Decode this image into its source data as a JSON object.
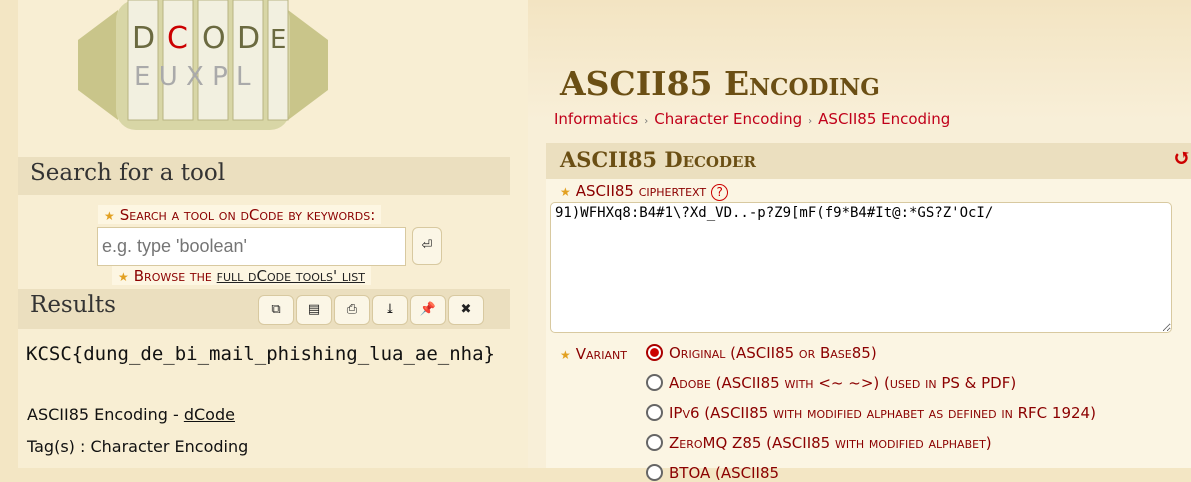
{
  "logo": {
    "text": "dCODE"
  },
  "search": {
    "heading": "Search for a tool",
    "label": "Search a tool on dCode by keywords:",
    "placeholder": "e.g. type 'boolean'",
    "go_icon": "⏎",
    "browse_prefix": "Browse the ",
    "browse_link": "full dCode tools' list"
  },
  "results": {
    "heading": "Results",
    "output": "KCSC{dung_de_bi_mail_phishing_lua_ae_nha}",
    "source_prefix": "ASCII85 Encoding - ",
    "source_link": "dCode",
    "tags": "Tag(s) : Character Encoding",
    "toolbar": [
      {
        "icon": "copy-icon",
        "glyph": "⧉"
      },
      {
        "icon": "scroll-icon",
        "glyph": "▤"
      },
      {
        "icon": "print-icon",
        "glyph": "⎙"
      },
      {
        "icon": "download-icon",
        "glyph": "⤓"
      },
      {
        "icon": "pin-icon",
        "glyph": "📌"
      },
      {
        "icon": "close-icon",
        "glyph": "✖"
      }
    ]
  },
  "page": {
    "title": "ASCII85 Encoding",
    "breadcrumb": [
      "Informatics",
      "Character Encoding",
      "ASCII85 Encoding"
    ]
  },
  "decoder": {
    "heading": "ASCII85 Decoder",
    "reset_icon": "↺",
    "ciphertext_label": "ASCII85 ciphertext",
    "help": "?",
    "ciphertext": "91)WFHXq8:B4#1\\?Xd_VD..-p?Z9[mF(f9*B4#It@:*GS?Z'OcI/",
    "variant_label": "Variant",
    "variants": [
      "Original (ASCII85 or Base85)",
      "Adobe (ASCII85 with <~ ~>) (used in PS & PDF)",
      "IPv6 (ASCII85 with modified alphabet as defined in RFC 1924)",
      "ZeroMQ Z85 (ASCII85 with modified alphabet)",
      "BTOA (ASCII85"
    ],
    "selected": 0
  }
}
